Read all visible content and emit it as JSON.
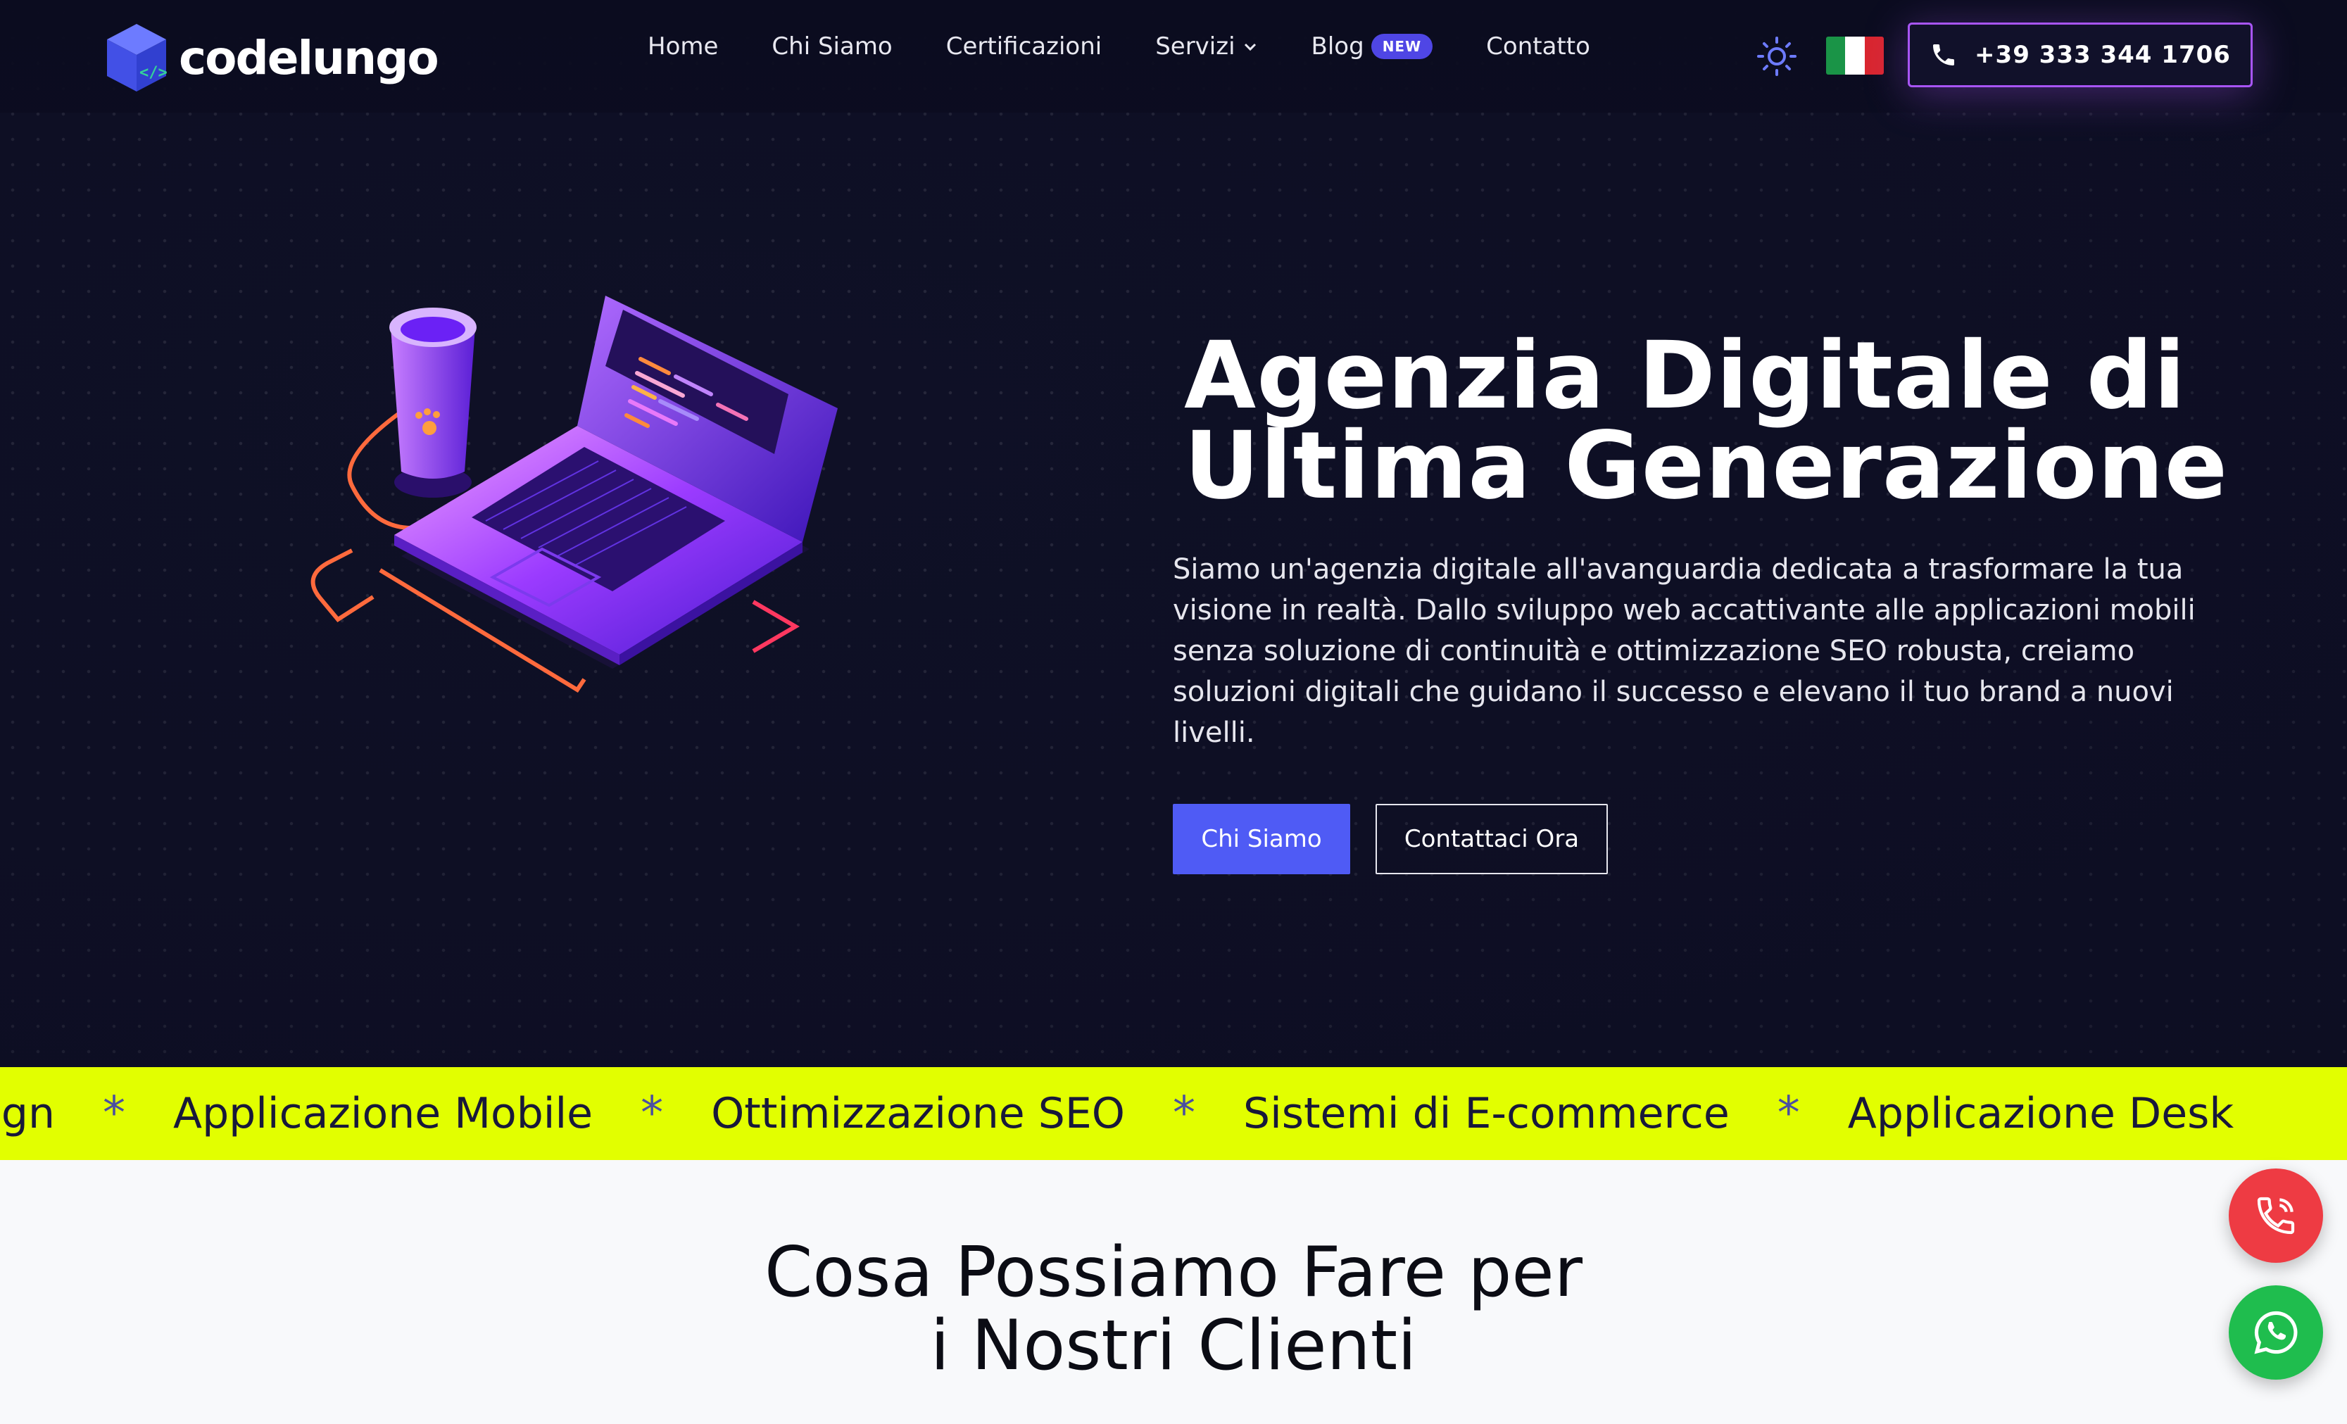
{
  "brand": {
    "name": "codelungo"
  },
  "nav": {
    "items": [
      {
        "label": "Home"
      },
      {
        "label": "Chi Siamo"
      },
      {
        "label": "Certificazioni"
      },
      {
        "label": "Servizi"
      },
      {
        "label": "Blog"
      },
      {
        "label": "Contatto"
      }
    ],
    "blog_badge": "NEW",
    "phone": "+39 333 344 1706",
    "language_flag": "flag-italy-icon",
    "theme_toggle": "sun-moon-icon"
  },
  "hero": {
    "title_line1": "Agenzia Digitale di",
    "title_line2": "Ultima Generazione",
    "description": "Siamo un'agenzia digitale all'avanguardia dedicata a trasformare la tua visione in realtà. Dallo sviluppo web accattivante alle applicazioni mobili senza soluzione di continuità e ottimizzazione SEO robusta, creiamo soluzioni digitali che guidano il successo e elevano il tuo brand a nuovi livelli.",
    "primary_button": "Chi Siamo",
    "secondary_button": "Contattaci Ora"
  },
  "marquee": {
    "items": [
      "sign",
      "Applicazione Mobile",
      "Ottimizzazione SEO",
      "Sistemi di E-commerce",
      "Applicazione Desk"
    ],
    "separator": "*"
  },
  "services": {
    "title": "Cosa Possiamo Fare per\ni Nostri Clienti"
  },
  "colors": {
    "hero_bg": "#0f1026",
    "accent": "#4f5bf5",
    "marquee_bg": "#e2ff00",
    "phone_border": "#a855f7",
    "call_fab": "#ee3b43",
    "whatsapp_fab": "#1fbd4e"
  }
}
